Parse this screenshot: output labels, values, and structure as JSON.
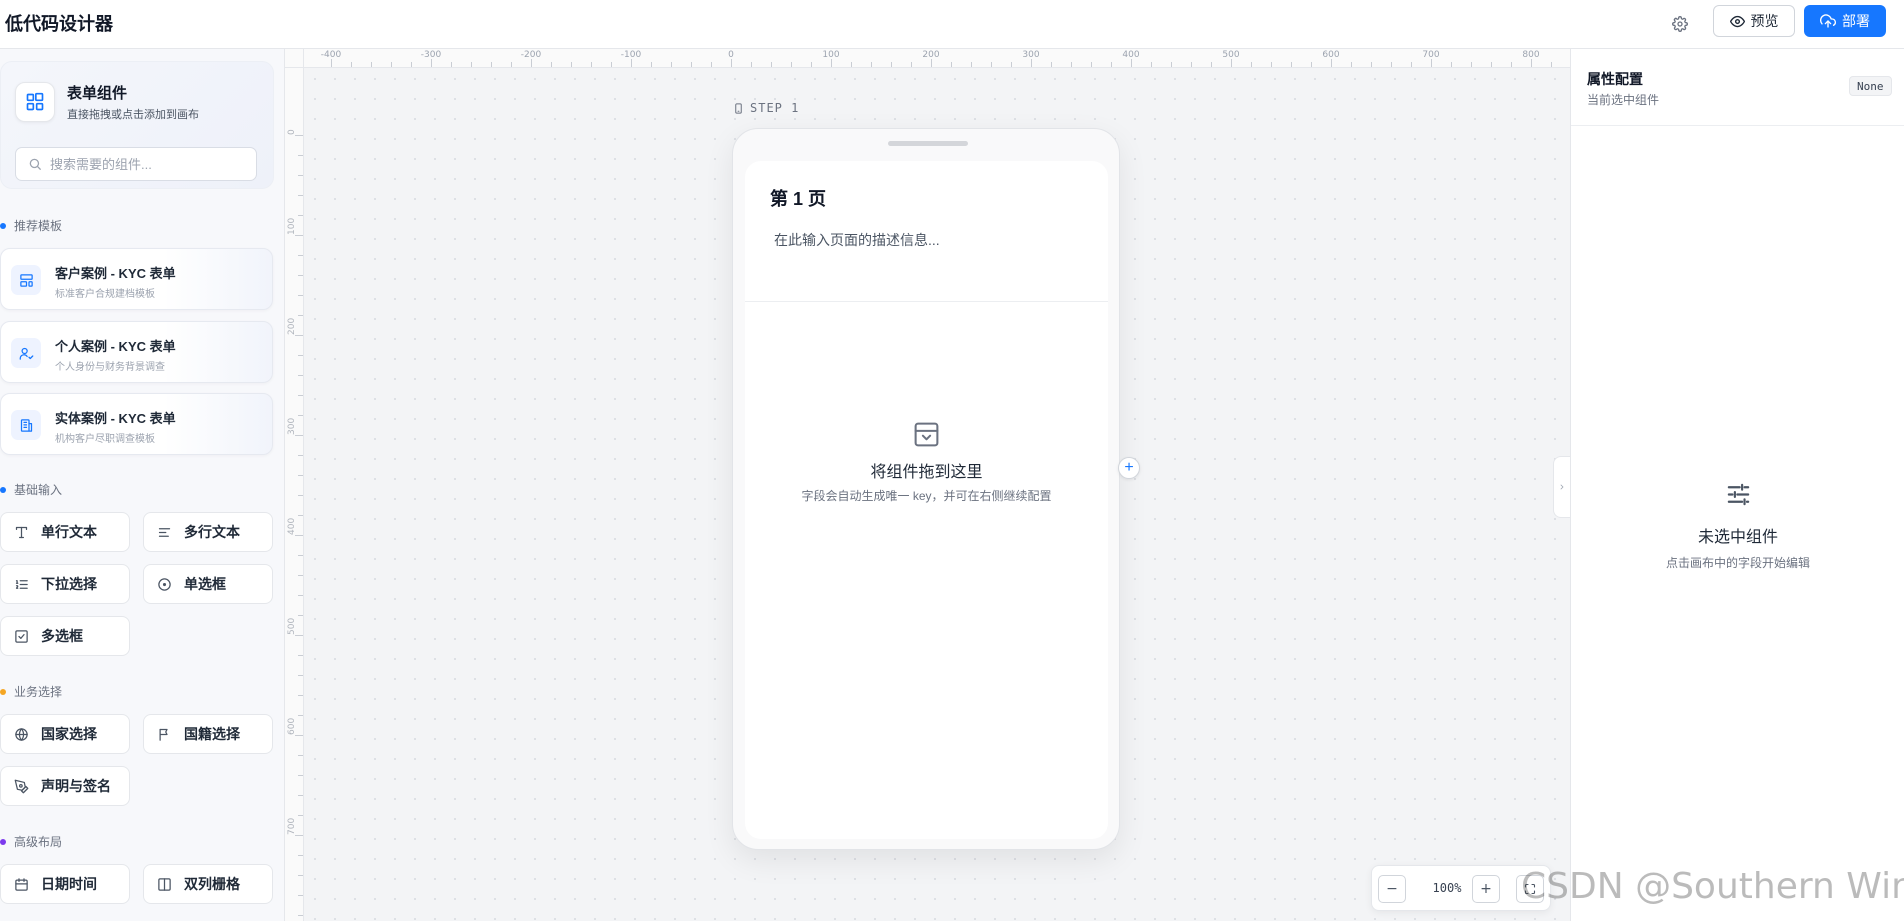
{
  "header": {
    "title": "低代码设计器",
    "preview_label": "预览",
    "deploy_label": "部署"
  },
  "sidebar": {
    "title": "表单组件",
    "subtitle": "直接拖拽或点击添加到画布",
    "search_placeholder": "搜索需要的组件...",
    "sections": [
      {
        "label": "推荐模板",
        "color": "#1677ff"
      },
      {
        "label": "基础输入",
        "color": "#1677ff"
      },
      {
        "label": "业务选择",
        "color": "#f5a623"
      },
      {
        "label": "高级布局",
        "color": "#7c3aed"
      }
    ],
    "templates": [
      {
        "title": "客户案例 - KYC 表单",
        "desc": "标准客户合规建档模板",
        "icon": "layout-template-icon"
      },
      {
        "title": "个人案例 - KYC 表单",
        "desc": "个人身份与财务背景调查",
        "icon": "user-check-icon"
      },
      {
        "title": "实体案例 - KYC 表单",
        "desc": "机构客户尽职调查模板",
        "icon": "building-icon"
      }
    ],
    "basic": [
      {
        "label": "单行文本",
        "icon": "type-icon"
      },
      {
        "label": "多行文本",
        "icon": "align-left-icon"
      },
      {
        "label": "下拉选择",
        "icon": "list-ordered-icon"
      },
      {
        "label": "单选框",
        "icon": "circle-dot-icon"
      },
      {
        "label": "多选框",
        "icon": "checkbox-icon"
      }
    ],
    "business": [
      {
        "label": "国家选择",
        "icon": "globe-icon"
      },
      {
        "label": "国籍选择",
        "icon": "flag-icon"
      },
      {
        "label": "声明与签名",
        "icon": "pen-icon"
      }
    ],
    "advanced": [
      {
        "label": "日期时间",
        "icon": "calendar-icon"
      },
      {
        "label": "双列栅格",
        "icon": "columns-icon"
      }
    ]
  },
  "canvas": {
    "step_label": "STEP 1",
    "page_title": "第 1 页",
    "page_desc": "在此输入页面的描述信息...",
    "drop_title": "将组件拖到这里",
    "drop_sub": "字段会自动生成唯一 key，并可在右侧继续配置",
    "zoom": "100%",
    "ruler_h": [
      "-400",
      "-300",
      "-200",
      "-100",
      "0",
      "100",
      "200",
      "300",
      "400",
      "500",
      "600",
      "700",
      "800"
    ],
    "ruler_v": [
      "0",
      "100",
      "200",
      "300",
      "400",
      "500",
      "600",
      "700"
    ]
  },
  "props_panel": {
    "title": "属性配置",
    "subtitle": "当前选中组件",
    "badge": "None",
    "empty_title": "未选中组件",
    "empty_sub": "点击画布中的字段开始编辑"
  },
  "watermark": "CSDN @Southern Wind"
}
